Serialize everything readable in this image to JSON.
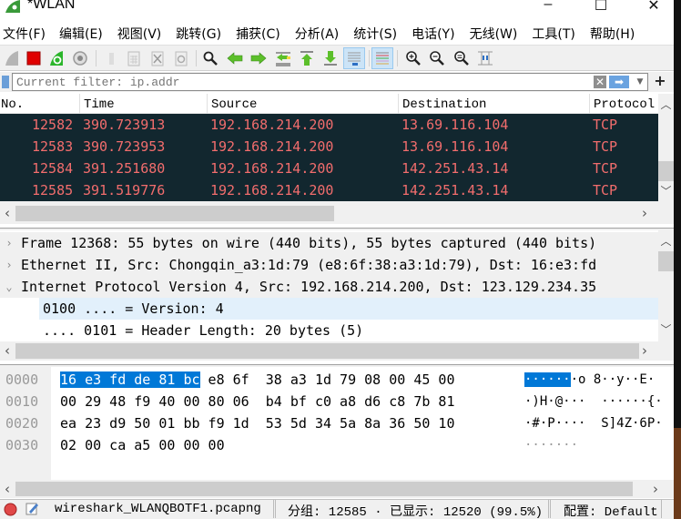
{
  "window": {
    "title": "*WLAN",
    "minimize": "–",
    "maximize": "☐",
    "close": "✕"
  },
  "menu": [
    {
      "label": "文件(F)"
    },
    {
      "label": "编辑(E)"
    },
    {
      "label": "视图(V)"
    },
    {
      "label": "跳转(G)"
    },
    {
      "label": "捕获(C)"
    },
    {
      "label": "分析(A)"
    },
    {
      "label": "统计(S)"
    },
    {
      "label": "电话(Y)"
    },
    {
      "label": "无线(W)"
    },
    {
      "label": "工具(T)"
    },
    {
      "label": "帮助(H)"
    }
  ],
  "toolbar": {
    "buttons": [
      {
        "name": "start-capture",
        "icon": "shark-fin-icon"
      },
      {
        "name": "stop-capture",
        "icon": "stop-icon"
      },
      {
        "name": "restart-capture",
        "icon": "restart-icon"
      },
      {
        "name": "capture-options",
        "icon": "gear-icon"
      },
      {
        "name": "open-file",
        "icon": "open-file-icon"
      },
      {
        "name": "save-file",
        "icon": "save-file-icon"
      },
      {
        "name": "close-file",
        "icon": "close-file-icon"
      },
      {
        "name": "reload-file",
        "icon": "reload-icon"
      },
      {
        "name": "find-packet",
        "icon": "search-icon"
      },
      {
        "name": "go-back",
        "icon": "arrow-left-icon"
      },
      {
        "name": "go-forward",
        "icon": "arrow-right-icon"
      },
      {
        "name": "go-to-packet",
        "icon": "go-to-packet-icon"
      },
      {
        "name": "first-packet",
        "icon": "arrow-top-icon"
      },
      {
        "name": "last-packet",
        "icon": "arrow-bottom-icon"
      },
      {
        "name": "auto-scroll",
        "icon": "auto-scroll-icon",
        "active": true
      },
      {
        "name": "colorize",
        "icon": "colorize-icon",
        "active": true
      },
      {
        "name": "zoom-in",
        "icon": "zoom-in-icon"
      },
      {
        "name": "zoom-out",
        "icon": "zoom-out-icon"
      },
      {
        "name": "zoom-reset",
        "icon": "zoom-reset-icon"
      },
      {
        "name": "resize-columns",
        "icon": "resize-columns-icon"
      }
    ]
  },
  "filter": {
    "placeholder": "Current filter: ip.addr",
    "value": "",
    "clear": "✕",
    "apply": "➡",
    "dropdown": "▼",
    "add": "+"
  },
  "packet_list": {
    "columns": [
      "No.",
      "Time",
      "Source",
      "Destination",
      "Protocol"
    ],
    "rows": [
      {
        "no": "12582",
        "time": "390.723913",
        "source": "192.168.214.200",
        "destination": "13.69.116.104",
        "protocol": "TCP"
      },
      {
        "no": "12583",
        "time": "390.723953",
        "source": "192.168.214.200",
        "destination": "13.69.116.104",
        "protocol": "TCP"
      },
      {
        "no": "12584",
        "time": "391.251680",
        "source": "192.168.214.200",
        "destination": "142.251.43.14",
        "protocol": "TCP"
      },
      {
        "no": "12585",
        "time": "391.519776",
        "source": "192.168.214.200",
        "destination": "142.251.43.14",
        "protocol": "TCP"
      }
    ],
    "row_bg": "#12272f",
    "row_fg": "#f26d6d"
  },
  "details": {
    "rows": [
      {
        "expander": "›",
        "text": "Frame 12368: 55 bytes on wire (440 bits), 55 bytes captured (440 bits)"
      },
      {
        "expander": "›",
        "text": "Ethernet II, Src: Chongqin_a3:1d:79 (e8:6f:38:a3:1d:79), Dst: 16:e3:fd"
      },
      {
        "expander": "⌄",
        "text": "Internet Protocol Version 4, Src: 192.168.214.200, Dst: 123.129.234.35"
      },
      {
        "expander": "",
        "text": "0100 .... = Version: 4"
      },
      {
        "expander": "",
        "text": ".... 0101 = Header Length: 20 bytes (5)"
      }
    ]
  },
  "bytes": {
    "rows": [
      {
        "offset": "0000",
        "hex_hl": "16 e3 fd de 81 bc",
        "hex_rest": " e8 6f  38 a3 1d 79 08 00 45 00",
        "ascii_hl": "······",
        "ascii_rest": "·o 8··y··E·"
      },
      {
        "offset": "0010",
        "hex_hl": "",
        "hex_rest": "00 29 48 f9 40 00 80 06  b4 bf c0 a8 d6 c8 7b 81",
        "ascii_hl": "",
        "ascii_rest": "·)H·@···  ······{·"
      },
      {
        "offset": "0020",
        "hex_hl": "",
        "hex_rest": "ea 23 d9 50 01 bb f9 1d  53 5d 34 5a 8a 36 50 10",
        "ascii_hl": "",
        "ascii_rest": "·#·P····  S]4Z·6P·"
      },
      {
        "offset": "0030",
        "hex_hl": "",
        "hex_rest": "02 00 ca a5 00 00 00",
        "ascii_hl": "",
        "ascii_rest": "·······"
      }
    ],
    "highlight": "#0078d7"
  },
  "status": {
    "file": "wireshark_WLANQBOTF1.pcapng",
    "packets": "分组: 12585 · 已显示: 12520 (99.5%)",
    "profile": "配置: Default"
  }
}
